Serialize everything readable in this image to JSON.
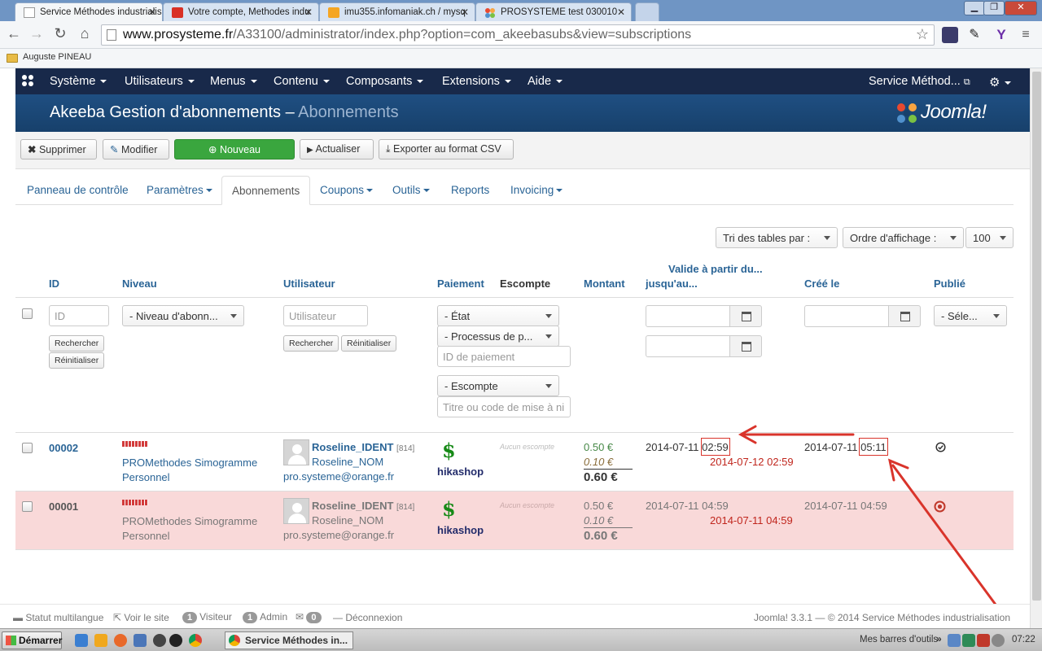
{
  "browser": {
    "tabs": [
      {
        "title": "Service Méthodes industrialis",
        "active": true,
        "icon": "page-icon"
      },
      {
        "title": "Votre compte, Methodes indu",
        "active": false,
        "icon": "gmail-icon"
      },
      {
        "title": "imu355.infomaniak.ch / mysq",
        "active": false,
        "icon": "phpmyadmin-icon"
      },
      {
        "title": "PROSYSTEME test 030010",
        "active": false,
        "icon": "joomla-icon"
      }
    ],
    "tab_close_glyph": "✕",
    "url_host": "www.prosysteme.fr",
    "url_path": "/A33100/administrator/index.php?option=com_akeebasubs&view=subscriptions",
    "bookmark": "Auguste PINEAU"
  },
  "joomla": {
    "menu": [
      "Système",
      "Utilisateurs",
      "Menus",
      "Contenu",
      "Composants",
      "Extensions",
      "Aide"
    ],
    "site_link": "Service Méthod...",
    "title_main": "Akeeba Gestion d'abonnements – ",
    "title_sub": "Abonnements",
    "brand": "Joomla!"
  },
  "toolbar": {
    "delete": "Supprimer",
    "edit": "Modifier",
    "new": "Nouveau",
    "refresh": "Actualiser",
    "export": "Exporter au format CSV"
  },
  "subtabs": [
    {
      "label": "Panneau de contrôle",
      "caret": false
    },
    {
      "label": "Paramètres",
      "caret": true
    },
    {
      "label": "Abonnements",
      "caret": false,
      "active": true
    },
    {
      "label": "Coupons",
      "caret": true
    },
    {
      "label": "Outils",
      "caret": true
    },
    {
      "label": "Reports",
      "caret": false
    },
    {
      "label": "Invoicing",
      "caret": true
    }
  ],
  "sorting": {
    "sort_by": "Tri des tables par :",
    "order": "Ordre d'affichage :",
    "limit": "100"
  },
  "columns": {
    "id": "ID",
    "level": "Niveau",
    "user": "Utilisateur",
    "payment": "Paiement",
    "discount": "Escompte",
    "amount": "Montant",
    "valid_from": "Valide à partir du...",
    "valid_to": "jusqu'au...",
    "created": "Créé le",
    "published": "Publié"
  },
  "filters": {
    "id_placeholder": "ID",
    "level": "- Niveau d'abonn...",
    "user_placeholder": "Utilisateur",
    "state": "- État",
    "processor": "- Processus de p...",
    "payment_id_placeholder": "ID de paiement",
    "discount": "- Escompte",
    "coupon_placeholder": "Titre ou code de mise à ni",
    "published": "- Séle...",
    "search": "Rechercher",
    "reset": "Réinitialiser"
  },
  "rows": [
    {
      "id": "00002",
      "level": "PROMethodes Simogramme Personnel",
      "username": "Roseline_IDENT",
      "user_id": "[814]",
      "name": "Roseline_NOM",
      "email": "pro.systeme@orange.fr",
      "payment_symbol": "$",
      "payment": "hikashop",
      "discount": "Aucun escompte",
      "net": "0.50 €",
      "tax": "0.10 €",
      "gross": "0.60 €",
      "from_date": "2014-07-11",
      "from_time": "02:59",
      "to": "2014-07-12 02:59",
      "created_date": "2014-07-11",
      "created_time": "05:11",
      "published": true
    },
    {
      "id": "00001",
      "level": "PROMethodes Simogramme Personnel",
      "username": "Roseline_IDENT",
      "user_id": "[814]",
      "name": "Roseline_NOM",
      "email": "pro.systeme@orange.fr",
      "payment_symbol": "$",
      "payment": "hikashop",
      "discount": "Aucun escompte",
      "net": "0.50 €",
      "tax": "0.10 €",
      "gross": "0.60 €",
      "from_date": "2014-07-11",
      "from_time": "04:59",
      "to": "2014-07-11 04:59",
      "created_date": "2014-07-11",
      "created_time": "04:59",
      "published": false
    }
  ],
  "footer": {
    "multilang": "Statut multilangue",
    "view_site": "Voir le site",
    "visitors_count": "1",
    "visitors": "Visiteur",
    "admin_count": "1",
    "admin": "Admin",
    "messages_count": "0",
    "logout": "Déconnexion",
    "version": "Joomla! 3.3.1 — © 2014 Service Méthodes industrialisation"
  },
  "taskbar": {
    "start": "Démarrer",
    "app": "Service Méthodes in...",
    "toolbars": "Mes barres d'outils",
    "clock": "07:22"
  },
  "colors": {
    "nav_bg": "#18294a",
    "header_bg": "#1f4f82",
    "link": "#2a6496",
    "unpublished_row": "#f9d9d9",
    "annotation": "#d9342b"
  }
}
